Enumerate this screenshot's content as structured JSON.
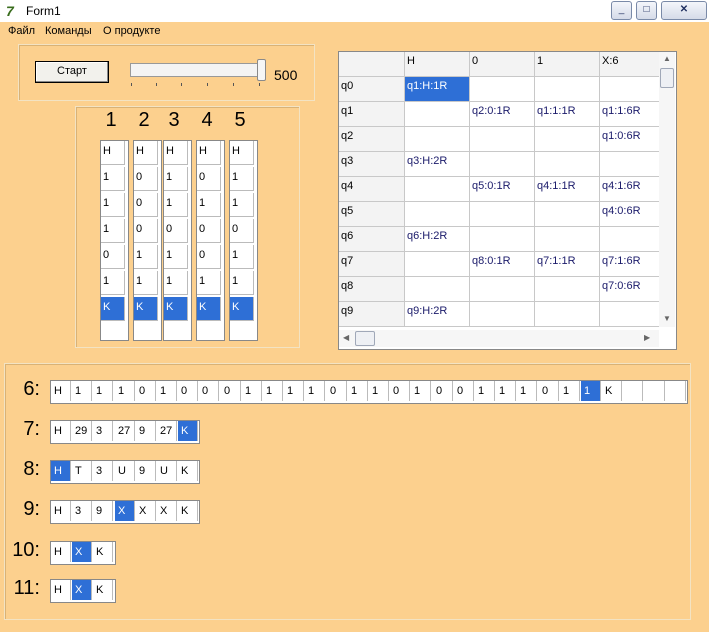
{
  "window": {
    "title": "Form1",
    "icon": "delphi-app-icon",
    "controls": [
      "minimize-icon",
      "maximize-icon",
      "close-icon"
    ]
  },
  "menu": [
    "Файл",
    "Команды",
    "О продукте"
  ],
  "controls": {
    "start_label": "Старт",
    "slider_value": "500"
  },
  "column_numbers": [
    "1",
    "2",
    "3",
    "4",
    "5"
  ],
  "vertical_tapes": [
    {
      "cells": [
        "H",
        "1",
        "1",
        "1",
        "0",
        "1",
        "K"
      ],
      "selected": 6
    },
    {
      "cells": [
        "H",
        "0",
        "0",
        "0",
        "1",
        "1",
        "K"
      ],
      "selected": 6
    },
    {
      "cells": [
        "H",
        "1",
        "1",
        "0",
        "1",
        "1",
        "K"
      ],
      "selected": 6
    },
    {
      "cells": [
        "H",
        "0",
        "1",
        "0",
        "0",
        "1",
        "K"
      ],
      "selected": 6
    },
    {
      "cells": [
        "H",
        "1",
        "1",
        "0",
        "1",
        "1",
        "K"
      ],
      "selected": 6
    }
  ],
  "state_table": {
    "headers": [
      "",
      "H",
      "0",
      "1",
      "X:6"
    ],
    "rows": [
      [
        "q0",
        "q1:H:1R",
        "",
        "",
        ""
      ],
      [
        "q1",
        "",
        "q2:0:1R",
        "q1:1:1R",
        "q1:1:6R"
      ],
      [
        "q2",
        "",
        "",
        "",
        "q1:0:6R"
      ],
      [
        "q3",
        "q3:H:2R",
        "",
        "",
        ""
      ],
      [
        "q4",
        "",
        "q5:0:1R",
        "q4:1:1R",
        "q4:1:6R"
      ],
      [
        "q5",
        "",
        "",
        "",
        "q4:0:6R"
      ],
      [
        "q6",
        "q6:H:2R",
        "",
        "",
        ""
      ],
      [
        "q7",
        "",
        "q8:0:1R",
        "q7:1:1R",
        "q7:1:6R"
      ],
      [
        "q8",
        "",
        "",
        "",
        "q7:0:6R"
      ],
      [
        "q9",
        "q9:H:2R",
        "",
        "",
        ""
      ]
    ],
    "selected": {
      "row": 0,
      "col": 1
    }
  },
  "horizontal_tapes": [
    {
      "label": "6:",
      "cells": [
        "H",
        "1",
        "1",
        "1",
        "0",
        "1",
        "0",
        "0",
        "0",
        "1",
        "1",
        "1",
        "1",
        "0",
        "1",
        "1",
        "0",
        "1",
        "0",
        "0",
        "1",
        "1",
        "1",
        "0",
        "1",
        "1",
        "K",
        "",
        "",
        ""
      ],
      "selected": 25
    },
    {
      "label": "7:",
      "cells": [
        "H",
        "29",
        "3",
        "27",
        "9",
        "27",
        "K"
      ],
      "selected": 6
    },
    {
      "label": "8:",
      "cells": [
        "H",
        "T",
        "3",
        "U",
        "9",
        "U",
        "K"
      ],
      "selected": 0
    },
    {
      "label": "9:",
      "cells": [
        "H",
        "3",
        "9",
        "X",
        "X",
        "X",
        "K"
      ],
      "selected": 3
    },
    {
      "label": "10:",
      "cells": [
        "H",
        "X",
        "K"
      ],
      "selected": 1
    },
    {
      "label": "11:",
      "cells": [
        "H",
        "X",
        "K"
      ],
      "selected": 1
    }
  ]
}
